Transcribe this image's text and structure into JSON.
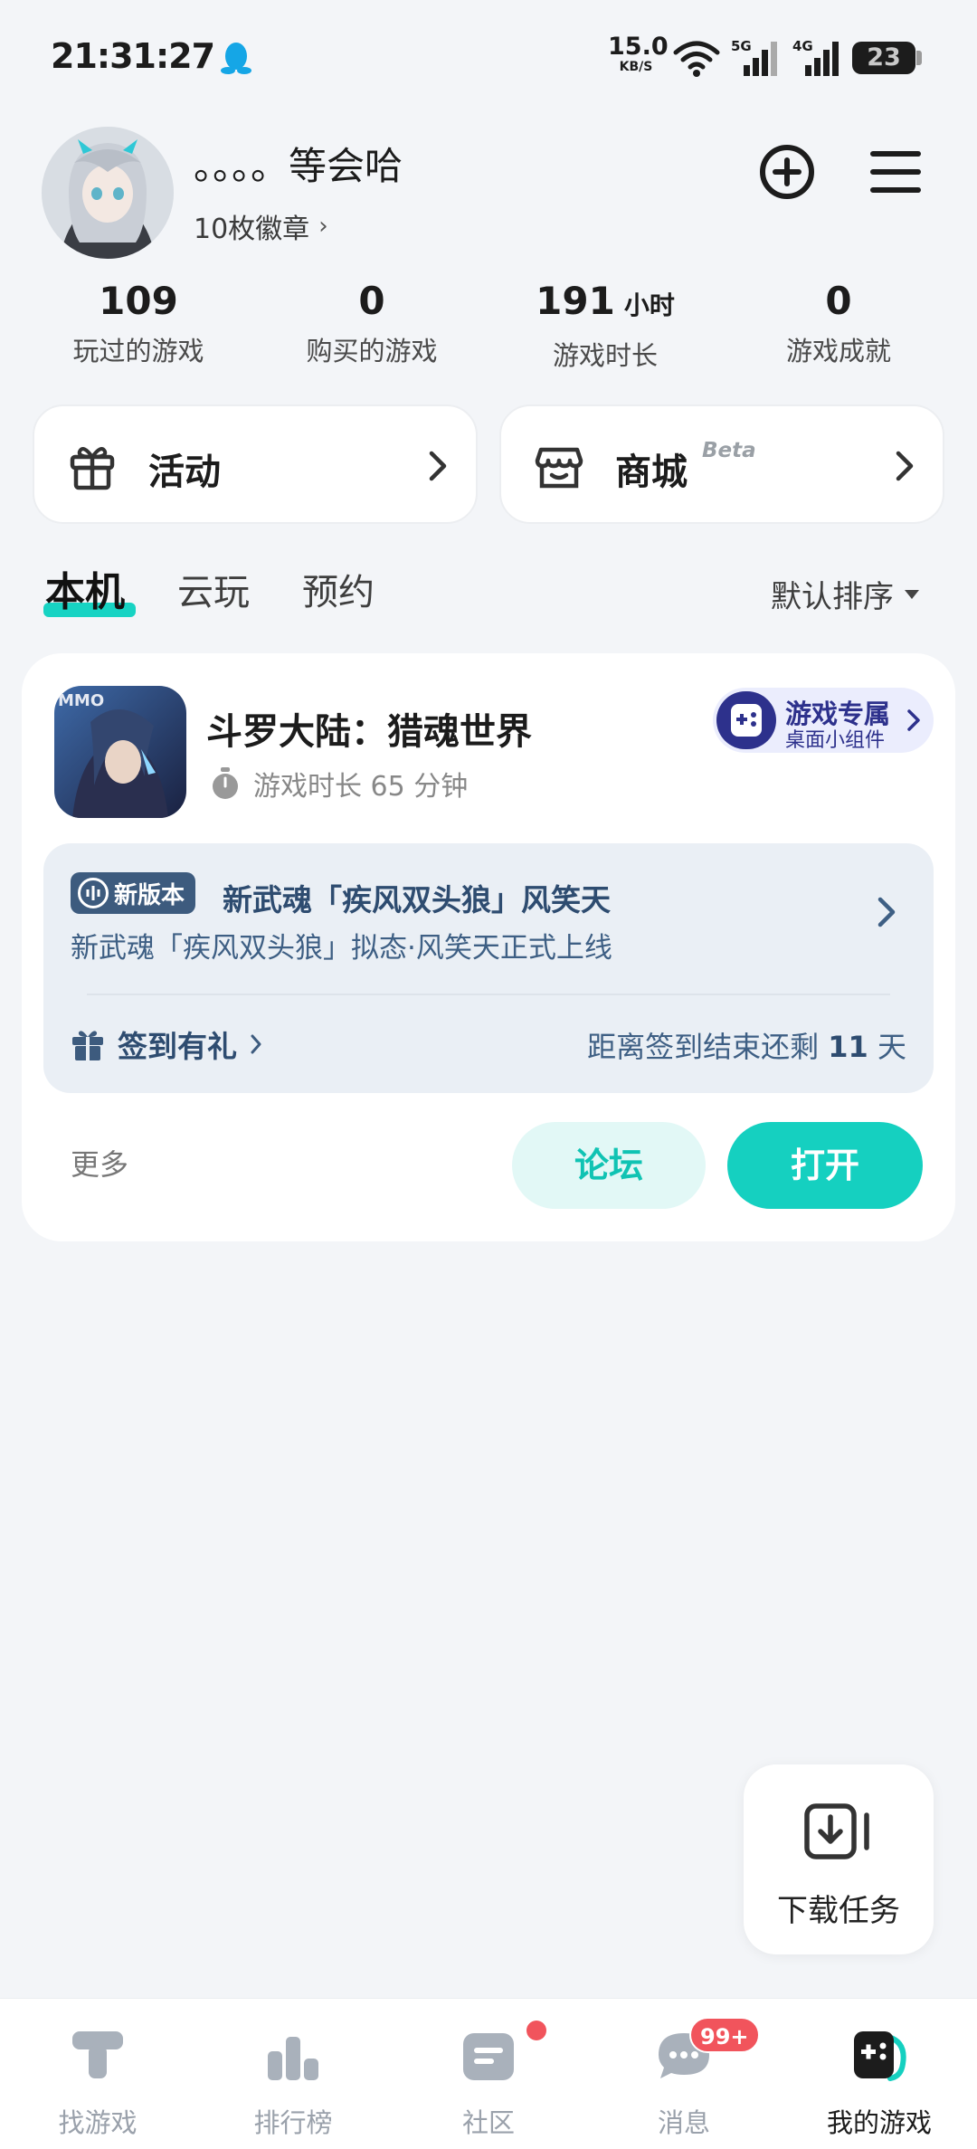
{
  "status_bar": {
    "time": "21:31:27",
    "net_speed_value": "15.0",
    "net_speed_unit": "KB/S",
    "signal_1": "5G",
    "signal_2": "4G",
    "battery_level": "23"
  },
  "profile": {
    "username": "。。。。等会哈",
    "badges_label": "10枚徽章",
    "add_icon": "plus-circle-icon",
    "menu_icon": "menu-icon"
  },
  "stats": [
    {
      "value": "109",
      "unit": "",
      "label": "玩过的游戏"
    },
    {
      "value": "0",
      "unit": "",
      "label": "购买的游戏"
    },
    {
      "value": "191",
      "unit": "小时",
      "label": "游戏时长"
    },
    {
      "value": "0",
      "unit": "",
      "label": "游戏成就"
    }
  ],
  "cards": {
    "activity": {
      "label": "活动",
      "icon": "gift-icon"
    },
    "store": {
      "label": "商城",
      "tag": "Beta",
      "icon": "shop-icon"
    }
  },
  "tabs": [
    {
      "label": "本机",
      "active": true
    },
    {
      "label": "云玩",
      "active": false
    },
    {
      "label": "预约",
      "active": false
    }
  ],
  "sort_label": "默认排序",
  "game": {
    "icon_text": "MMO",
    "title": "斗罗大陆：猎魂世界",
    "playtime": "游戏时长 65 分钟",
    "widget_line1": "游戏专属",
    "widget_line2": "桌面小组件",
    "news_tag": "新版本",
    "news_title": "新武魂「疾风双头狼」风笑天",
    "news_desc": "新武魂「疾风双头狼」拟态·风笑天正式上线",
    "signin_label": "签到有礼",
    "signin_prefix": "距离签到结束还剩 ",
    "signin_days": "11",
    "signin_suffix": " 天",
    "more_label": "更多",
    "forum_label": "论坛",
    "open_label": "打开"
  },
  "download_task_label": "下载任务",
  "bottom_nav": [
    {
      "label": "找游戏",
      "icon": "find-game-icon"
    },
    {
      "label": "排行榜",
      "icon": "ranking-icon"
    },
    {
      "label": "社区",
      "icon": "community-icon"
    },
    {
      "label": "消息",
      "icon": "message-icon",
      "badge": "99+"
    },
    {
      "label": "我的游戏",
      "icon": "my-games-icon",
      "active": true
    }
  ],
  "colors": {
    "accent": "#15d0c0",
    "news_text": "#3e5f84",
    "badge_red": "#f1545c"
  }
}
